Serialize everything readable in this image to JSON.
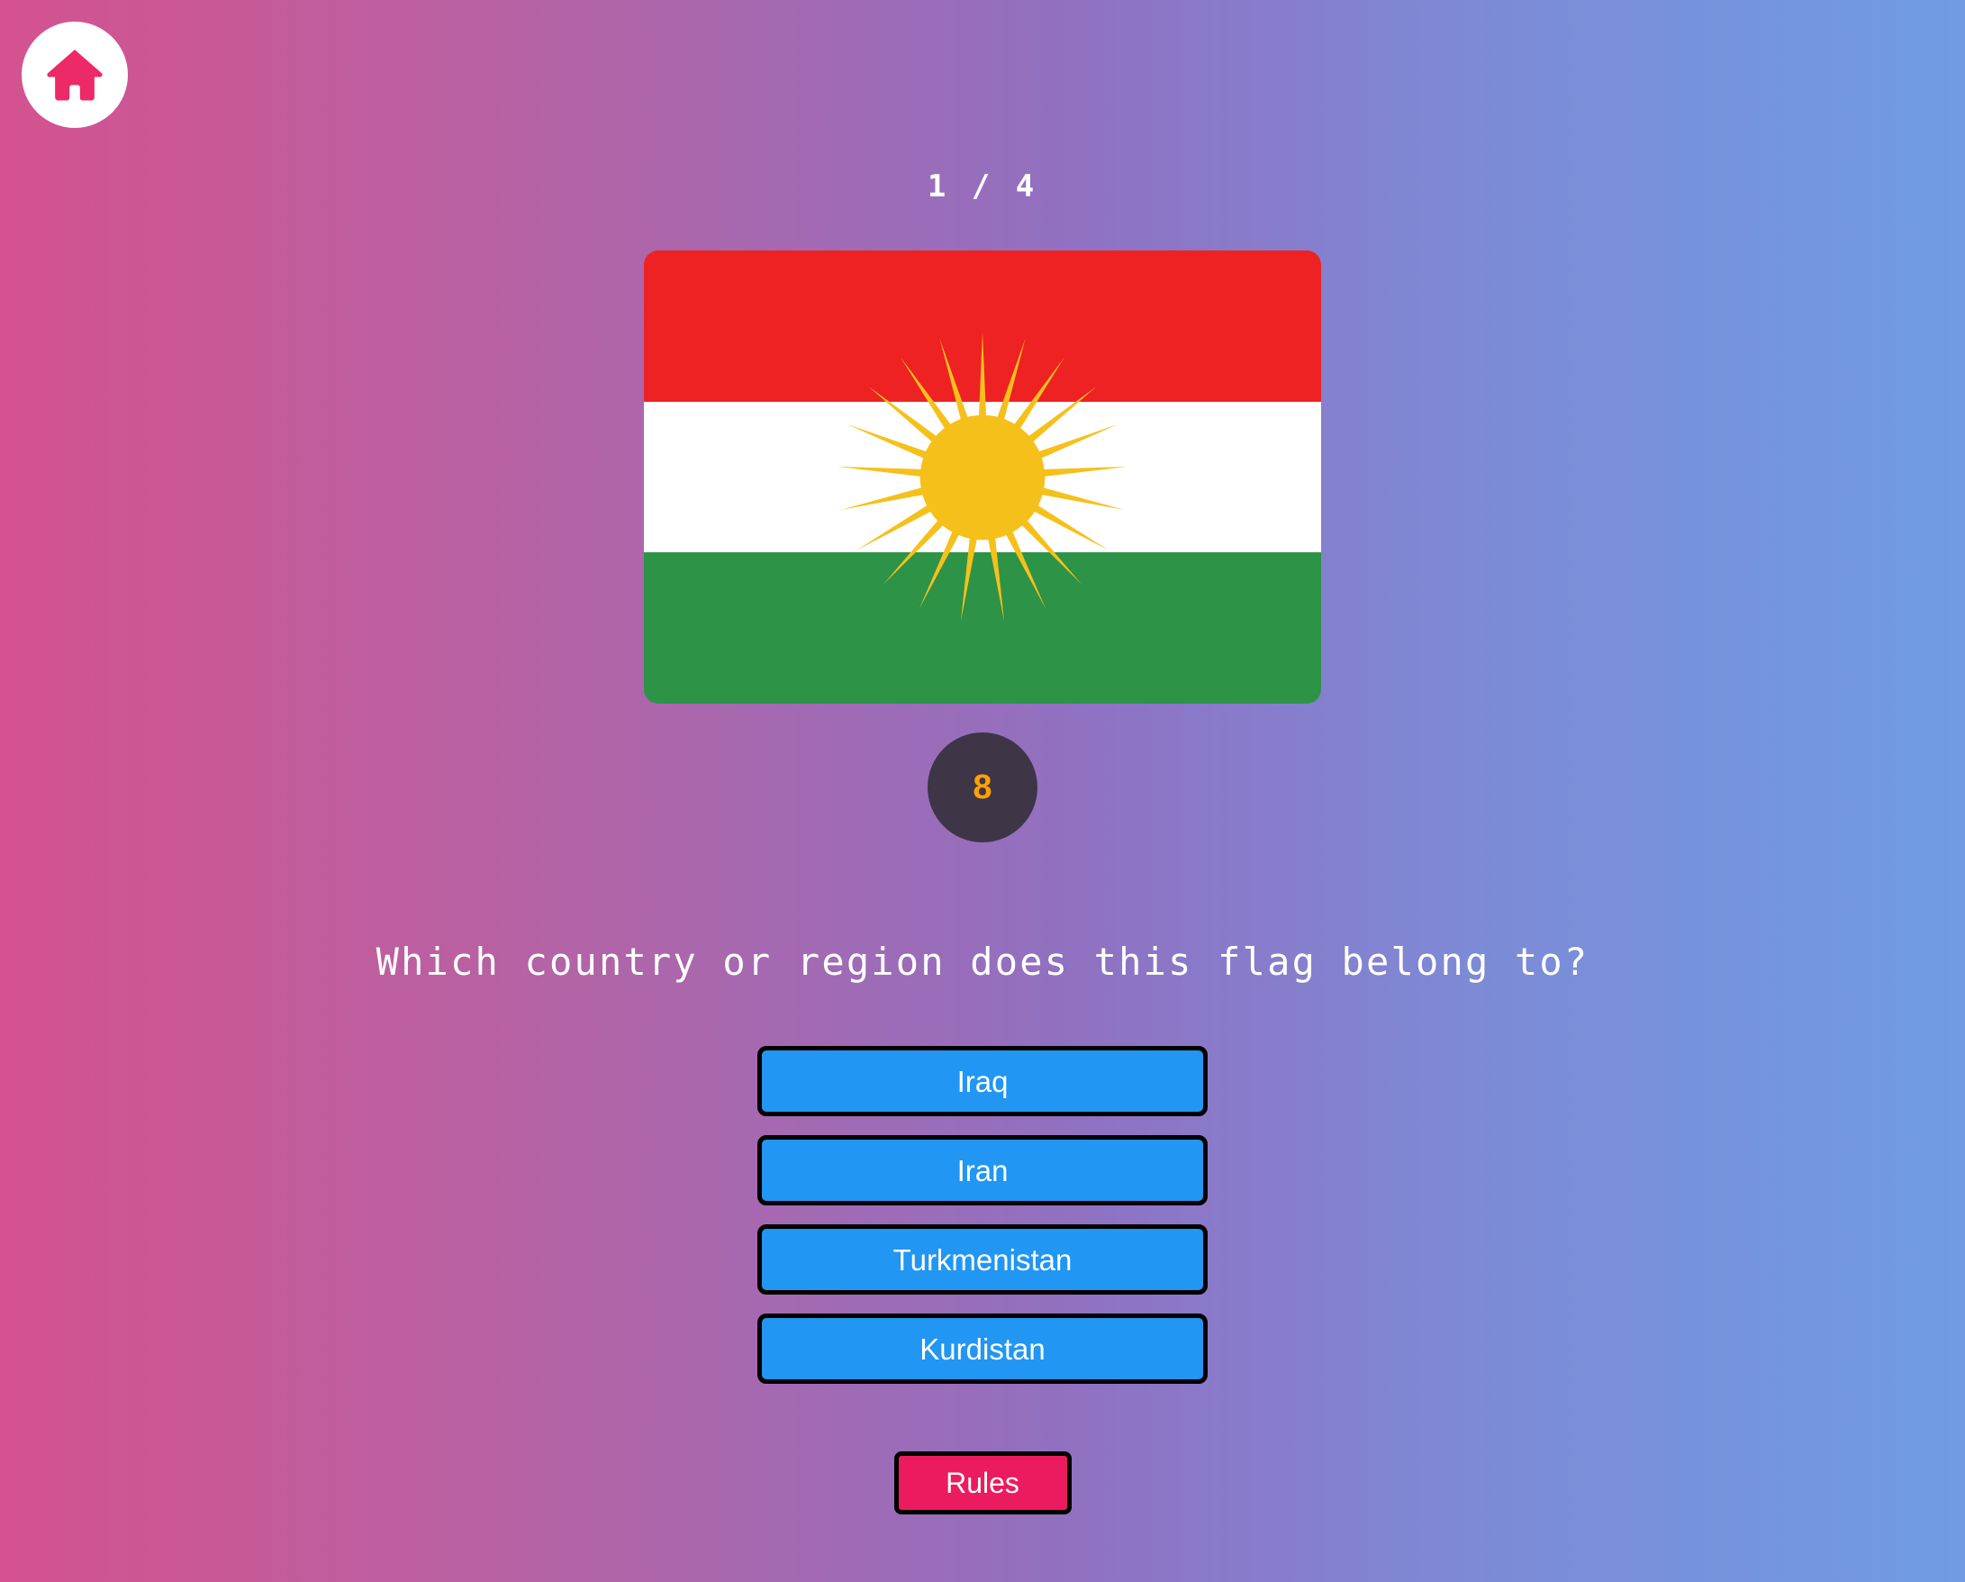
{
  "app": {
    "background_gradient_from": "#d4528f",
    "background_gradient_to": "#6f9ce3"
  },
  "nav": {
    "home_icon": "home-icon",
    "home_icon_color": "#ec2a68"
  },
  "quiz": {
    "progress": "1 / 4",
    "current_question_number": 1,
    "total_questions": 4,
    "timer_value": "8",
    "timer_color": "#ffa200",
    "timer_background": "#3e3547",
    "question": "Which country or region does this flag belong to?",
    "flag": {
      "name": "kurdistan-flag",
      "band_top_color": "#ee2222",
      "band_middle_color": "#ffffff",
      "band_bottom_color": "#2c9347",
      "emblem": "sun-icon",
      "emblem_color": "#f6c01b",
      "emblem_rays": 21
    },
    "answers": [
      {
        "label": "Iraq"
      },
      {
        "label": "Iran"
      },
      {
        "label": "Turkmenistan"
      },
      {
        "label": "Kurdistan"
      }
    ],
    "answer_color": "#2196f3"
  },
  "footer": {
    "rules_label": "Rules",
    "rules_color": "#ec1a5e"
  }
}
